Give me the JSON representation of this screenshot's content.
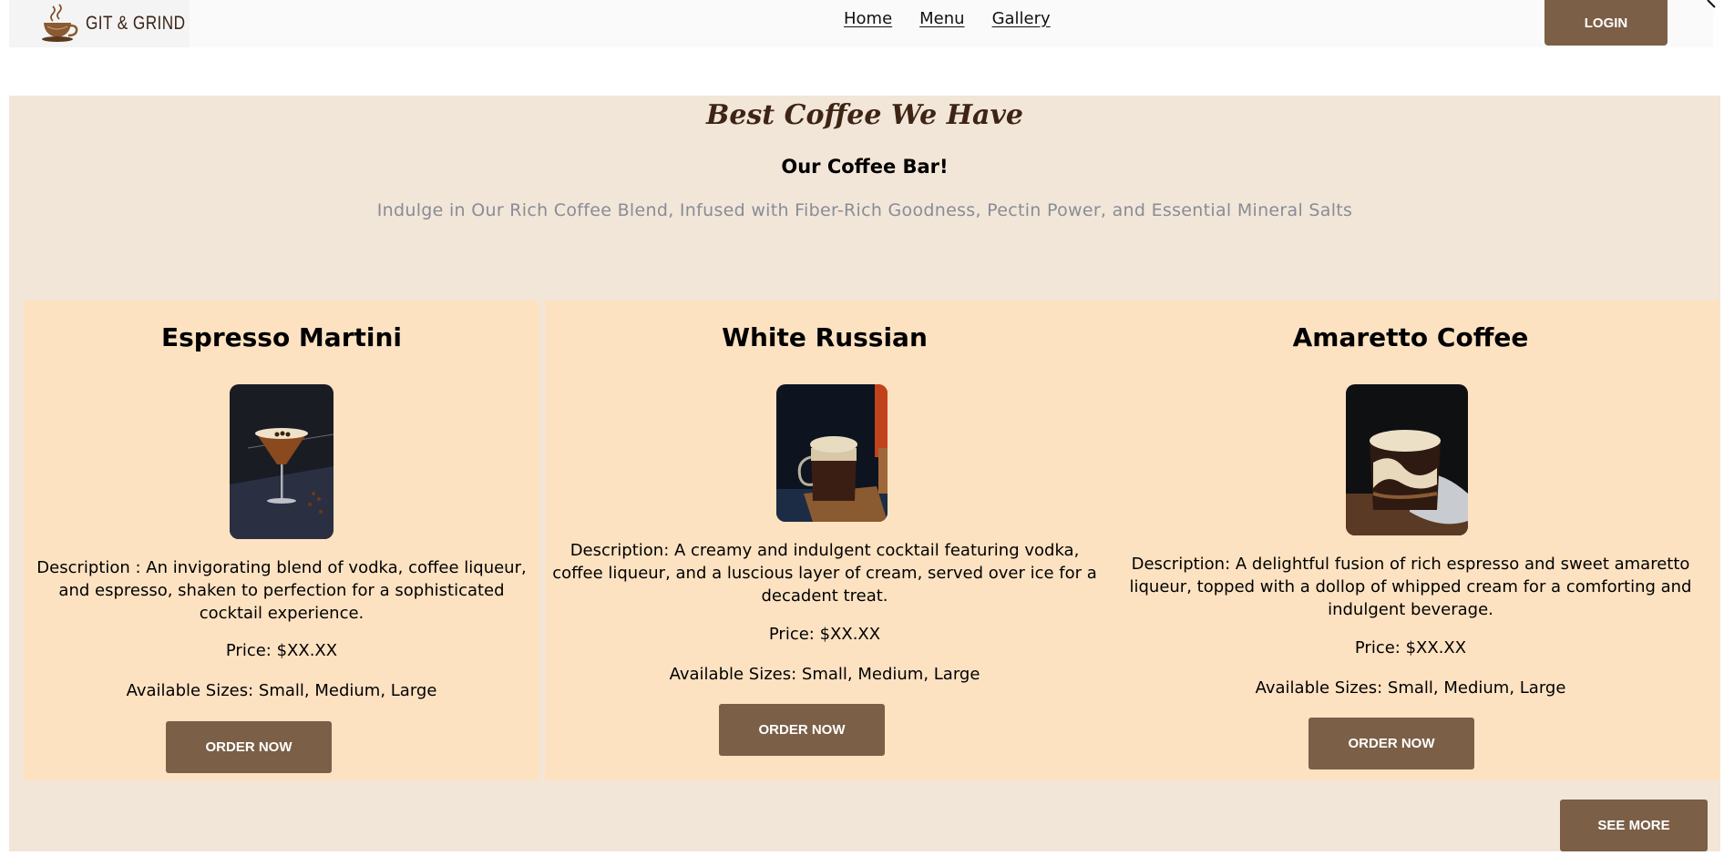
{
  "brand": {
    "name": "GIT & GRIND",
    "icon": "coffee-cup-icon"
  },
  "nav": {
    "items": [
      {
        "label": "Home"
      },
      {
        "label": "Menu"
      },
      {
        "label": "Gallery"
      }
    ],
    "login_label": "LOGIN"
  },
  "section": {
    "title": "Best Coffee We Have",
    "subtitle": "Our Coffee Bar!",
    "tagline": "Indulge in Our Rich Coffee Blend, Infused with Fiber-Rich Goodness, Pectin Power, and Essential Mineral Salts"
  },
  "cards": [
    {
      "title": "Espresso Martini",
      "image": "espresso-martini-image",
      "description": "Description : An invigorating blend of vodka, coffee liqueur, and espresso, shaken to perfection for a sophisticated cocktail experience.",
      "price": "Price: $XX.XX",
      "sizes": "Available Sizes: Small, Medium, Large",
      "button": "ORDER NOW"
    },
    {
      "title": "White Russian",
      "image": "white-russian-image",
      "description": "Description: A creamy and indulgent cocktail featuring vodka, coffee liqueur, and a luscious layer of cream, served over ice for a decadent treat.",
      "price": "Price: $XX.XX",
      "sizes": "Available Sizes: Small, Medium, Large",
      "button": "ORDER NOW"
    },
    {
      "title": "Amaretto Coffee",
      "image": "amaretto-coffee-image",
      "description": "Description: A delightful fusion of rich espresso and sweet amaretto liqueur, topped with a dollop of whipped cream for a comforting and indulgent beverage.",
      "price": "Price: $XX.XX",
      "sizes": "Available Sizes: Small, Medium, Large",
      "button": "ORDER NOW"
    }
  ],
  "see_more_label": "SEE MORE",
  "colors": {
    "button": "#7b5f46",
    "section_bg": "#f2e6d8",
    "card_bg": "#fde2c2",
    "title": "#3d2414",
    "tagline": "#888c97"
  }
}
